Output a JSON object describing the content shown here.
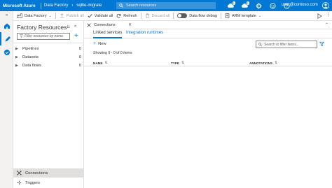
{
  "header": {
    "brand": "Microsoft Azure",
    "breadcrumb": [
      "Data Factory",
      "sqlite-migrate"
    ],
    "search_placeholder": "Search resources",
    "badges": [
      "1",
      "1"
    ],
    "user": "user@contoso.com",
    "colors": {
      "bar": "#0078d4",
      "accent": "#0078d4"
    }
  },
  "rail": {
    "items": [
      "home-icon",
      "pencil-icon",
      "monitor-icon"
    ]
  },
  "toolbar": {
    "data_factory": "Data Factory",
    "publish_all": "Publish all",
    "validate_all": "Validate all",
    "refresh": "Refresh",
    "discard_all": "Discard all",
    "data_flow_debug": "Data flow debug",
    "arm_template": "ARM template"
  },
  "factory_resources": {
    "title": "Factory Resources",
    "filter_placeholder": "Filter resources by name",
    "items": [
      {
        "label": "Pipelines",
        "count": "0"
      },
      {
        "label": "Datasets",
        "count": "0"
      },
      {
        "label": "Data flows",
        "count": "0"
      }
    ],
    "bottom": [
      {
        "label": "Connections"
      },
      {
        "label": "Triggers"
      }
    ]
  },
  "main": {
    "tab_label": "Connections",
    "subtabs": [
      "Linked services",
      "Integration runtimes"
    ],
    "new_label": "New",
    "filter_placeholder": "Search to filter items...",
    "showing": "Showing 0 - 0 of 0 items",
    "columns": [
      "NAME",
      "TYPE",
      "ANNOTATIONS"
    ]
  }
}
